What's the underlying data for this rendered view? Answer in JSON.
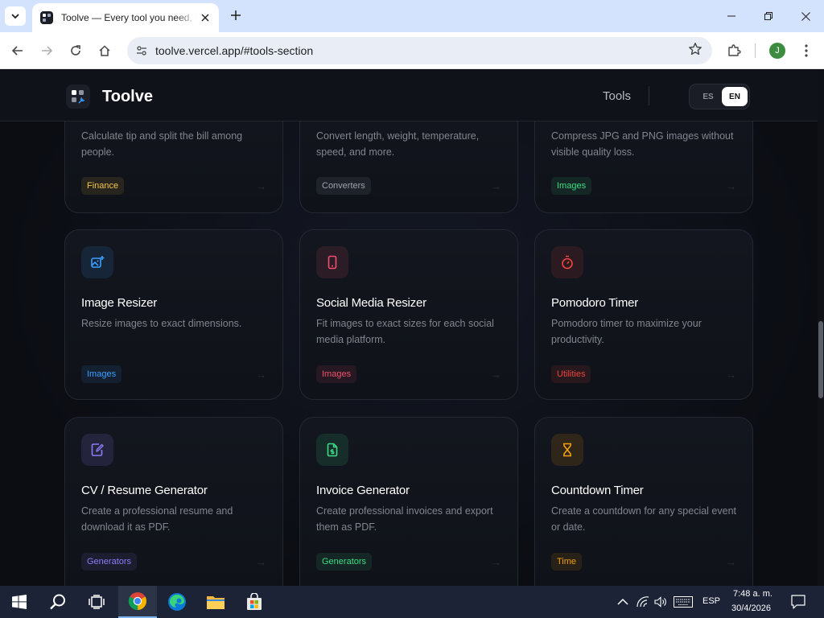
{
  "browser": {
    "tab_title": "Toolve — Every tool you need, in one place",
    "url": "toolve.vercel.app/#tools-section",
    "profile_initial": "J"
  },
  "site": {
    "brand": "Toolve",
    "nav_tools": "Tools",
    "lang_es": "ES",
    "lang_en": "EN"
  },
  "cards_top": [
    {
      "desc": "Calculate tip and split the bill among people.",
      "badge": "Finance",
      "badge_color": "#f5c542"
    },
    {
      "desc": "Convert length, weight, temperature, speed, and more.",
      "badge": "Converters",
      "badge_color": "#9ca3af"
    },
    {
      "desc": "Compress JPG and PNG images without visible quality loss.",
      "badge": "Images",
      "badge_color": "#3ddc84"
    }
  ],
  "cards_mid": [
    {
      "title": "Image Resizer",
      "desc": "Resize images to exact dimensions.",
      "badge": "Images",
      "badge_color": "#3b9eff",
      "icon": "image-plus-icon"
    },
    {
      "title": "Social Media Resizer",
      "desc": "Fit images to exact sizes for each social media platform.",
      "badge": "Images",
      "badge_color": "#f0506e",
      "icon": "smartphone-icon"
    },
    {
      "title": "Pomodoro Timer",
      "desc": "Pomodoro timer to maximize your productivity.",
      "badge": "Utilities",
      "badge_color": "#f0443e",
      "icon": "timer-icon"
    }
  ],
  "cards_bottom": [
    {
      "title": "CV / Resume Generator",
      "desc": "Create a professional resume and download it as PDF.",
      "badge": "Generators",
      "badge_color": "#8b7cf6",
      "icon": "file-edit-icon"
    },
    {
      "title": "Invoice Generator",
      "desc": "Create professional invoices and export them as PDF.",
      "badge": "Generators",
      "badge_color": "#3ddc84",
      "icon": "invoice-icon"
    },
    {
      "title": "Countdown Timer",
      "desc": "Create a countdown for any special event or date.",
      "badge": "Time",
      "badge_color": "#f59e0b",
      "icon": "hourglass-icon"
    }
  ],
  "card_arrow": "→",
  "taskbar": {
    "lang": "ESP",
    "time": "7:48 a. m.",
    "date": "30/4/2026"
  }
}
